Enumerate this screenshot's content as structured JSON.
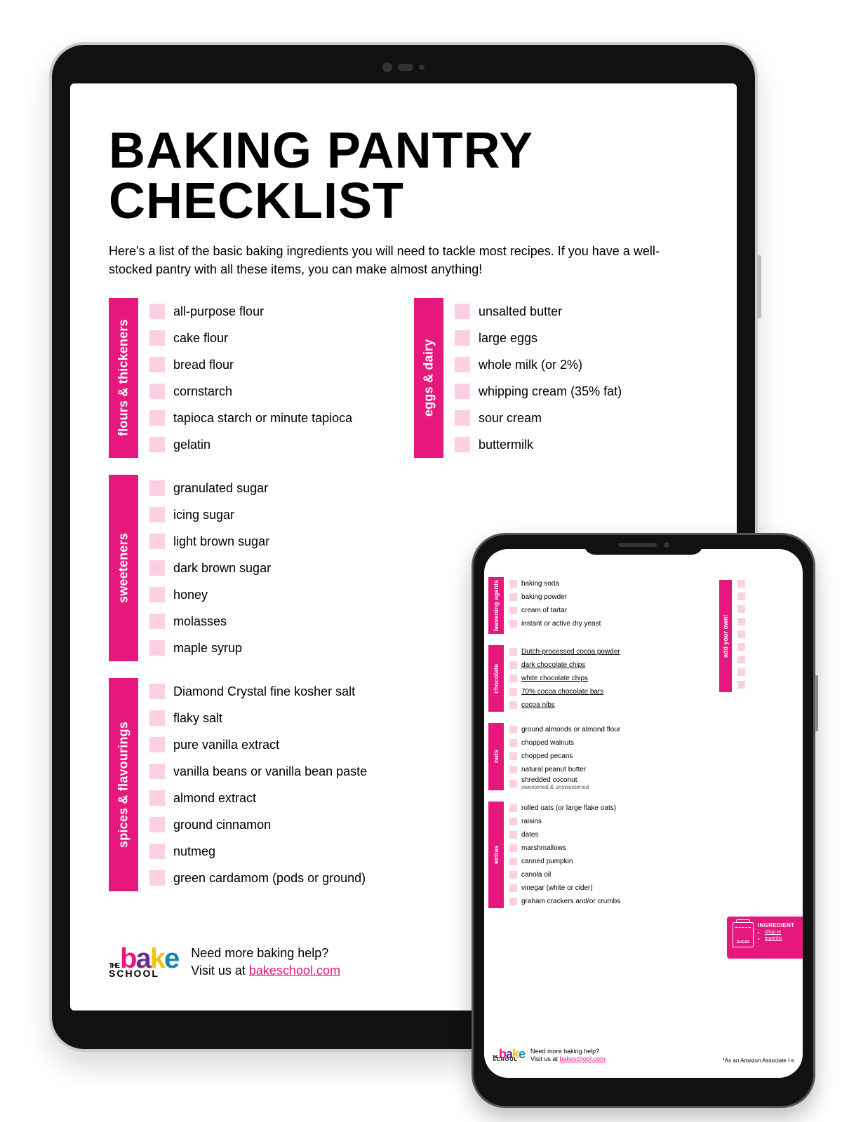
{
  "tablet": {
    "title": "BAKING PANTRY CHECKLIST",
    "intro": "Here's a list of the basic baking ingredients you will need to tackle most recipes. If you have a well-stocked pantry with all these items, you can make almost anything!",
    "categories_left": [
      {
        "label": "flours & thickeners",
        "items": [
          "all-purpose flour",
          "cake flour",
          "bread flour",
          "cornstarch",
          "tapioca starch or minute tapioca",
          "gelatin"
        ]
      },
      {
        "label": "sweeteners",
        "items": [
          "granulated sugar",
          "icing sugar",
          "light brown sugar",
          "dark brown sugar",
          "honey",
          "molasses",
          "maple syrup"
        ]
      },
      {
        "label": "spices & flavourings",
        "items": [
          "Diamond Crystal fine kosher salt",
          "flaky salt",
          "pure vanilla extract",
          "vanilla beans or vanilla bean paste",
          "almond extract",
          "ground cinnamon",
          "nutmeg",
          "green cardamom (pods or ground)"
        ]
      }
    ],
    "categories_right": [
      {
        "label": "eggs & dairy",
        "items": [
          "unsalted butter",
          "large eggs",
          "whole milk (or 2%)",
          "whipping cream (35% fat)",
          "sour cream",
          "buttermilk"
        ]
      }
    ],
    "footer": {
      "logo_the": "THE",
      "logo_word": [
        "b",
        "a",
        "k",
        "e"
      ],
      "logo_school": "SCHOOL",
      "help_line1": "Need more baking help?",
      "help_line2_a": "Visit us at ",
      "help_link": "bakeschool.com"
    }
  },
  "phone": {
    "categories_left": [
      {
        "label": "leavening agents",
        "items": [
          "baking soda",
          "baking powder",
          "cream of tartar",
          "instant or active dry yeast"
        ]
      },
      {
        "label": "chocolate",
        "underline": true,
        "items": [
          "Dutch-processed cocoa powder",
          "dark chocolate chips",
          "white chocolate chips",
          "70% cocoa chocolate bars",
          "cocoa nibs"
        ]
      },
      {
        "label": "nuts",
        "items": [
          "ground almonds or almond flour",
          "chopped walnuts",
          "chopped pecans",
          "natural peanut butter",
          "shredded coconut"
        ],
        "subnote_index": 4,
        "subnote": "sweetened & unsweetened"
      },
      {
        "label": "extras",
        "items": [
          "rolled oats (or large flake oats)",
          "raisins",
          "dates",
          "marshmallows",
          "canned pumpkin",
          "canola oil",
          "vinegar (white or cider)",
          "graham crackers and/or crumbs"
        ]
      }
    ],
    "add_own_label": "add your own!",
    "add_own_count": 9,
    "card": {
      "jar_label": "SUGAR",
      "heading": "INGREDIENT",
      "bullets": [
        "shop m",
        "ingredie"
      ]
    },
    "footer": {
      "logo_the": "THE",
      "logo_word": [
        "b",
        "a",
        "k",
        "e"
      ],
      "logo_school": "SCHOOL",
      "help_line1": "Need more baking help?",
      "help_line2_a": "Visit us at ",
      "help_link": "bakeschool.com",
      "disclaimer": "*As an Amazon Associate I e"
    }
  }
}
